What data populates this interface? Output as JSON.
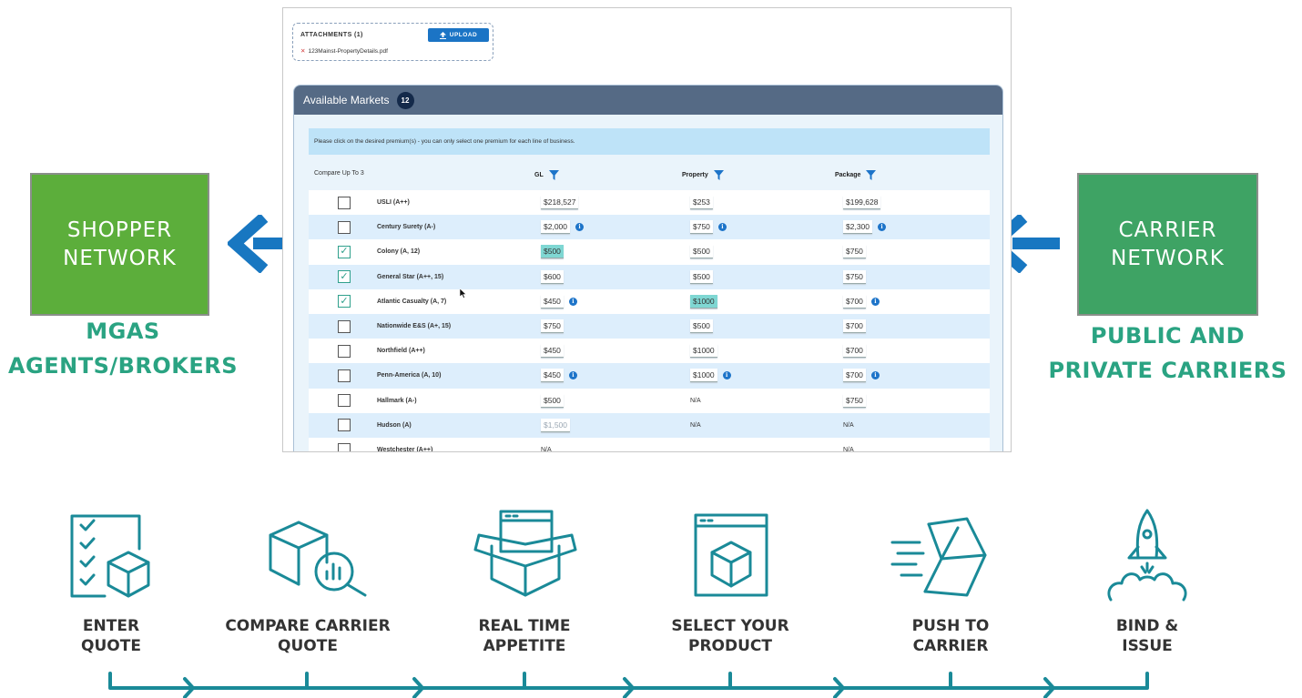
{
  "left_network": {
    "title_line1": "SHOPPER",
    "title_line2": "NETWORK",
    "sub_line1": "MGAS",
    "sub_line2": "AGENTS/BROKERS"
  },
  "right_network": {
    "title_line1": "CARRIER",
    "title_line2": "NETWORK",
    "sub_line1": "PUBLIC AND",
    "sub_line2": "PRIVATE CARRIERS"
  },
  "attachments": {
    "title": "ATTACHMENTS (1)",
    "upload_label": "UPLOAD",
    "file_name": "123Mainst-PropertyDetails.pdf"
  },
  "markets": {
    "title": "Available Markets",
    "count": "12",
    "notice": "Please click on the desired premium(s) - you can only select one premium for each line of business.",
    "compare_label": "Compare Up To 3",
    "columns": [
      "GL",
      "Property",
      "Package"
    ],
    "rows": [
      {
        "checked": false,
        "name": "USLI (A++)",
        "gl": "$218,527",
        "gl_state": "normal",
        "gl_info": false,
        "prop": "$253",
        "prop_state": "normal",
        "prop_info": false,
        "pkg": "$199,628",
        "pkg_state": "normal",
        "pkg_info": false
      },
      {
        "checked": false,
        "name": "Century Surety (A-)",
        "gl": "$2,000",
        "gl_state": "normal",
        "gl_info": true,
        "prop": "$750",
        "prop_state": "normal",
        "prop_info": true,
        "pkg": "$2,300",
        "pkg_state": "normal",
        "pkg_info": true
      },
      {
        "checked": true,
        "name": "Colony (A, 12)",
        "gl": "$500",
        "gl_state": "selected",
        "gl_info": false,
        "prop": "$500",
        "prop_state": "normal",
        "prop_info": false,
        "pkg": "$750",
        "pkg_state": "normal",
        "pkg_info": false
      },
      {
        "checked": true,
        "name": "General Star (A++, 15)",
        "gl": "$600",
        "gl_state": "normal",
        "gl_info": false,
        "prop": "$500",
        "prop_state": "normal",
        "prop_info": false,
        "pkg": "$750",
        "pkg_state": "normal",
        "pkg_info": false
      },
      {
        "checked": true,
        "name": "Atlantic Casualty (A, 7)",
        "gl": "$450",
        "gl_state": "normal",
        "gl_info": true,
        "prop": "$1000",
        "prop_state": "selected",
        "prop_info": false,
        "pkg": "$700",
        "pkg_state": "normal",
        "pkg_info": true
      },
      {
        "checked": false,
        "name": "Nationwide E&S (A+, 15)",
        "gl": "$750",
        "gl_state": "normal",
        "gl_info": false,
        "prop": "$500",
        "prop_state": "normal",
        "prop_info": false,
        "pkg": "$700",
        "pkg_state": "normal",
        "pkg_info": false
      },
      {
        "checked": false,
        "name": "Northfield (A++)",
        "gl": "$450",
        "gl_state": "normal",
        "gl_info": false,
        "prop": "$1000",
        "prop_state": "normal",
        "prop_info": false,
        "pkg": "$700",
        "pkg_state": "normal",
        "pkg_info": false
      },
      {
        "checked": false,
        "name": "Penn-America (A, 10)",
        "gl": "$450",
        "gl_state": "normal",
        "gl_info": true,
        "prop": "$1000",
        "prop_state": "normal",
        "prop_info": true,
        "pkg": "$700",
        "pkg_state": "normal",
        "pkg_info": true
      },
      {
        "checked": false,
        "name": "Hallmark (A-)",
        "gl": "$500",
        "gl_state": "normal",
        "gl_info": false,
        "prop": "N/A",
        "prop_state": "na",
        "prop_info": false,
        "pkg": "$750",
        "pkg_state": "normal",
        "pkg_info": false
      },
      {
        "checked": false,
        "name": "Hudson (A)",
        "gl": "$1,500",
        "gl_state": "dim",
        "gl_info": false,
        "prop": "N/A",
        "prop_state": "na",
        "prop_info": false,
        "pkg": "N/A",
        "pkg_state": "na",
        "pkg_info": false
      },
      {
        "checked": false,
        "name": "Westchester (A++)",
        "gl": "N/A",
        "gl_state": "na",
        "gl_info": false,
        "prop": "",
        "prop_state": "blank",
        "prop_info": false,
        "pkg": "N/A",
        "pkg_state": "na",
        "pkg_info": false
      }
    ]
  },
  "steps": [
    {
      "line1": "ENTER",
      "line2": "QUOTE",
      "icon": "checklist-box-icon"
    },
    {
      "line1": "COMPARE CARRIER",
      "line2": "QUOTE",
      "icon": "box-magnifier-chart-icon"
    },
    {
      "line1": "REAL TIME",
      "line2": "APPETITE",
      "icon": "open-box-window-icon"
    },
    {
      "line1": "SELECT YOUR",
      "line2": "PRODUCT",
      "icon": "window-box-icon"
    },
    {
      "line1": "PUSH TO",
      "line2": "CARRIER",
      "icon": "moving-box-icon"
    },
    {
      "line1": "BIND &",
      "line2": "ISSUE",
      "icon": "rocket-launch-icon"
    }
  ],
  "colors": {
    "shopper_green": "#5cae3b",
    "carrier_green": "#3ea364",
    "label_teal": "#2aa382",
    "arrow_blue": "#1877c1",
    "icon_teal": "#1a8a98",
    "header_slate": "#556a85"
  }
}
